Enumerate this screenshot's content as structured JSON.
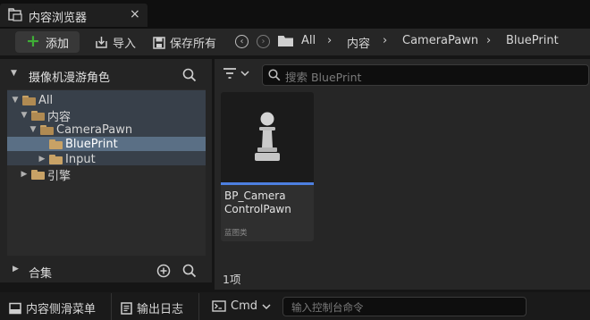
{
  "tab": {
    "title": "内容浏览器",
    "close": "×"
  },
  "toolbar": {
    "add_label": "添加",
    "import_label": "导入",
    "save_all_label": "保存所有",
    "breadcrumbs": [
      "All",
      "内容",
      "CameraPawn",
      "BluePrint"
    ],
    "separator": "›"
  },
  "sources": {
    "title": "摄像机漫游角色",
    "tree": [
      {
        "label": "All",
        "expanded": true
      },
      {
        "label": "内容",
        "expanded": true
      },
      {
        "label": "CameraPawn",
        "expanded": true
      },
      {
        "label": "BluePrint",
        "selected": true
      },
      {
        "label": "Input",
        "expanded": false
      },
      {
        "label": "引擎",
        "expanded": false
      }
    ],
    "collections_label": "合集"
  },
  "content": {
    "search_placeholder": "搜索 BluePrint",
    "asset": {
      "name": "BP_Camera\nControlPawn",
      "type": "蓝图类",
      "accent": "#4d7fe0"
    },
    "item_count": "1项"
  },
  "bottom": {
    "drawer_label": "内容侧滑菜单",
    "output_log_label": "输出日志",
    "cmd_label": "Cmd",
    "cmd_placeholder": "输入控制台命令"
  },
  "colors": {
    "add_icon": "#3fae36",
    "folder": "#c8a266",
    "selection": "#5a6f85"
  },
  "icons": [
    "content-browser-icon",
    "import-icon",
    "save-icon",
    "back-icon",
    "forward-icon",
    "folder-icon",
    "search-icon",
    "filter-icon",
    "chevron-down-icon",
    "add-circle-icon",
    "pawn-icon",
    "drawer-icon",
    "output-log-icon",
    "terminal-icon"
  ]
}
